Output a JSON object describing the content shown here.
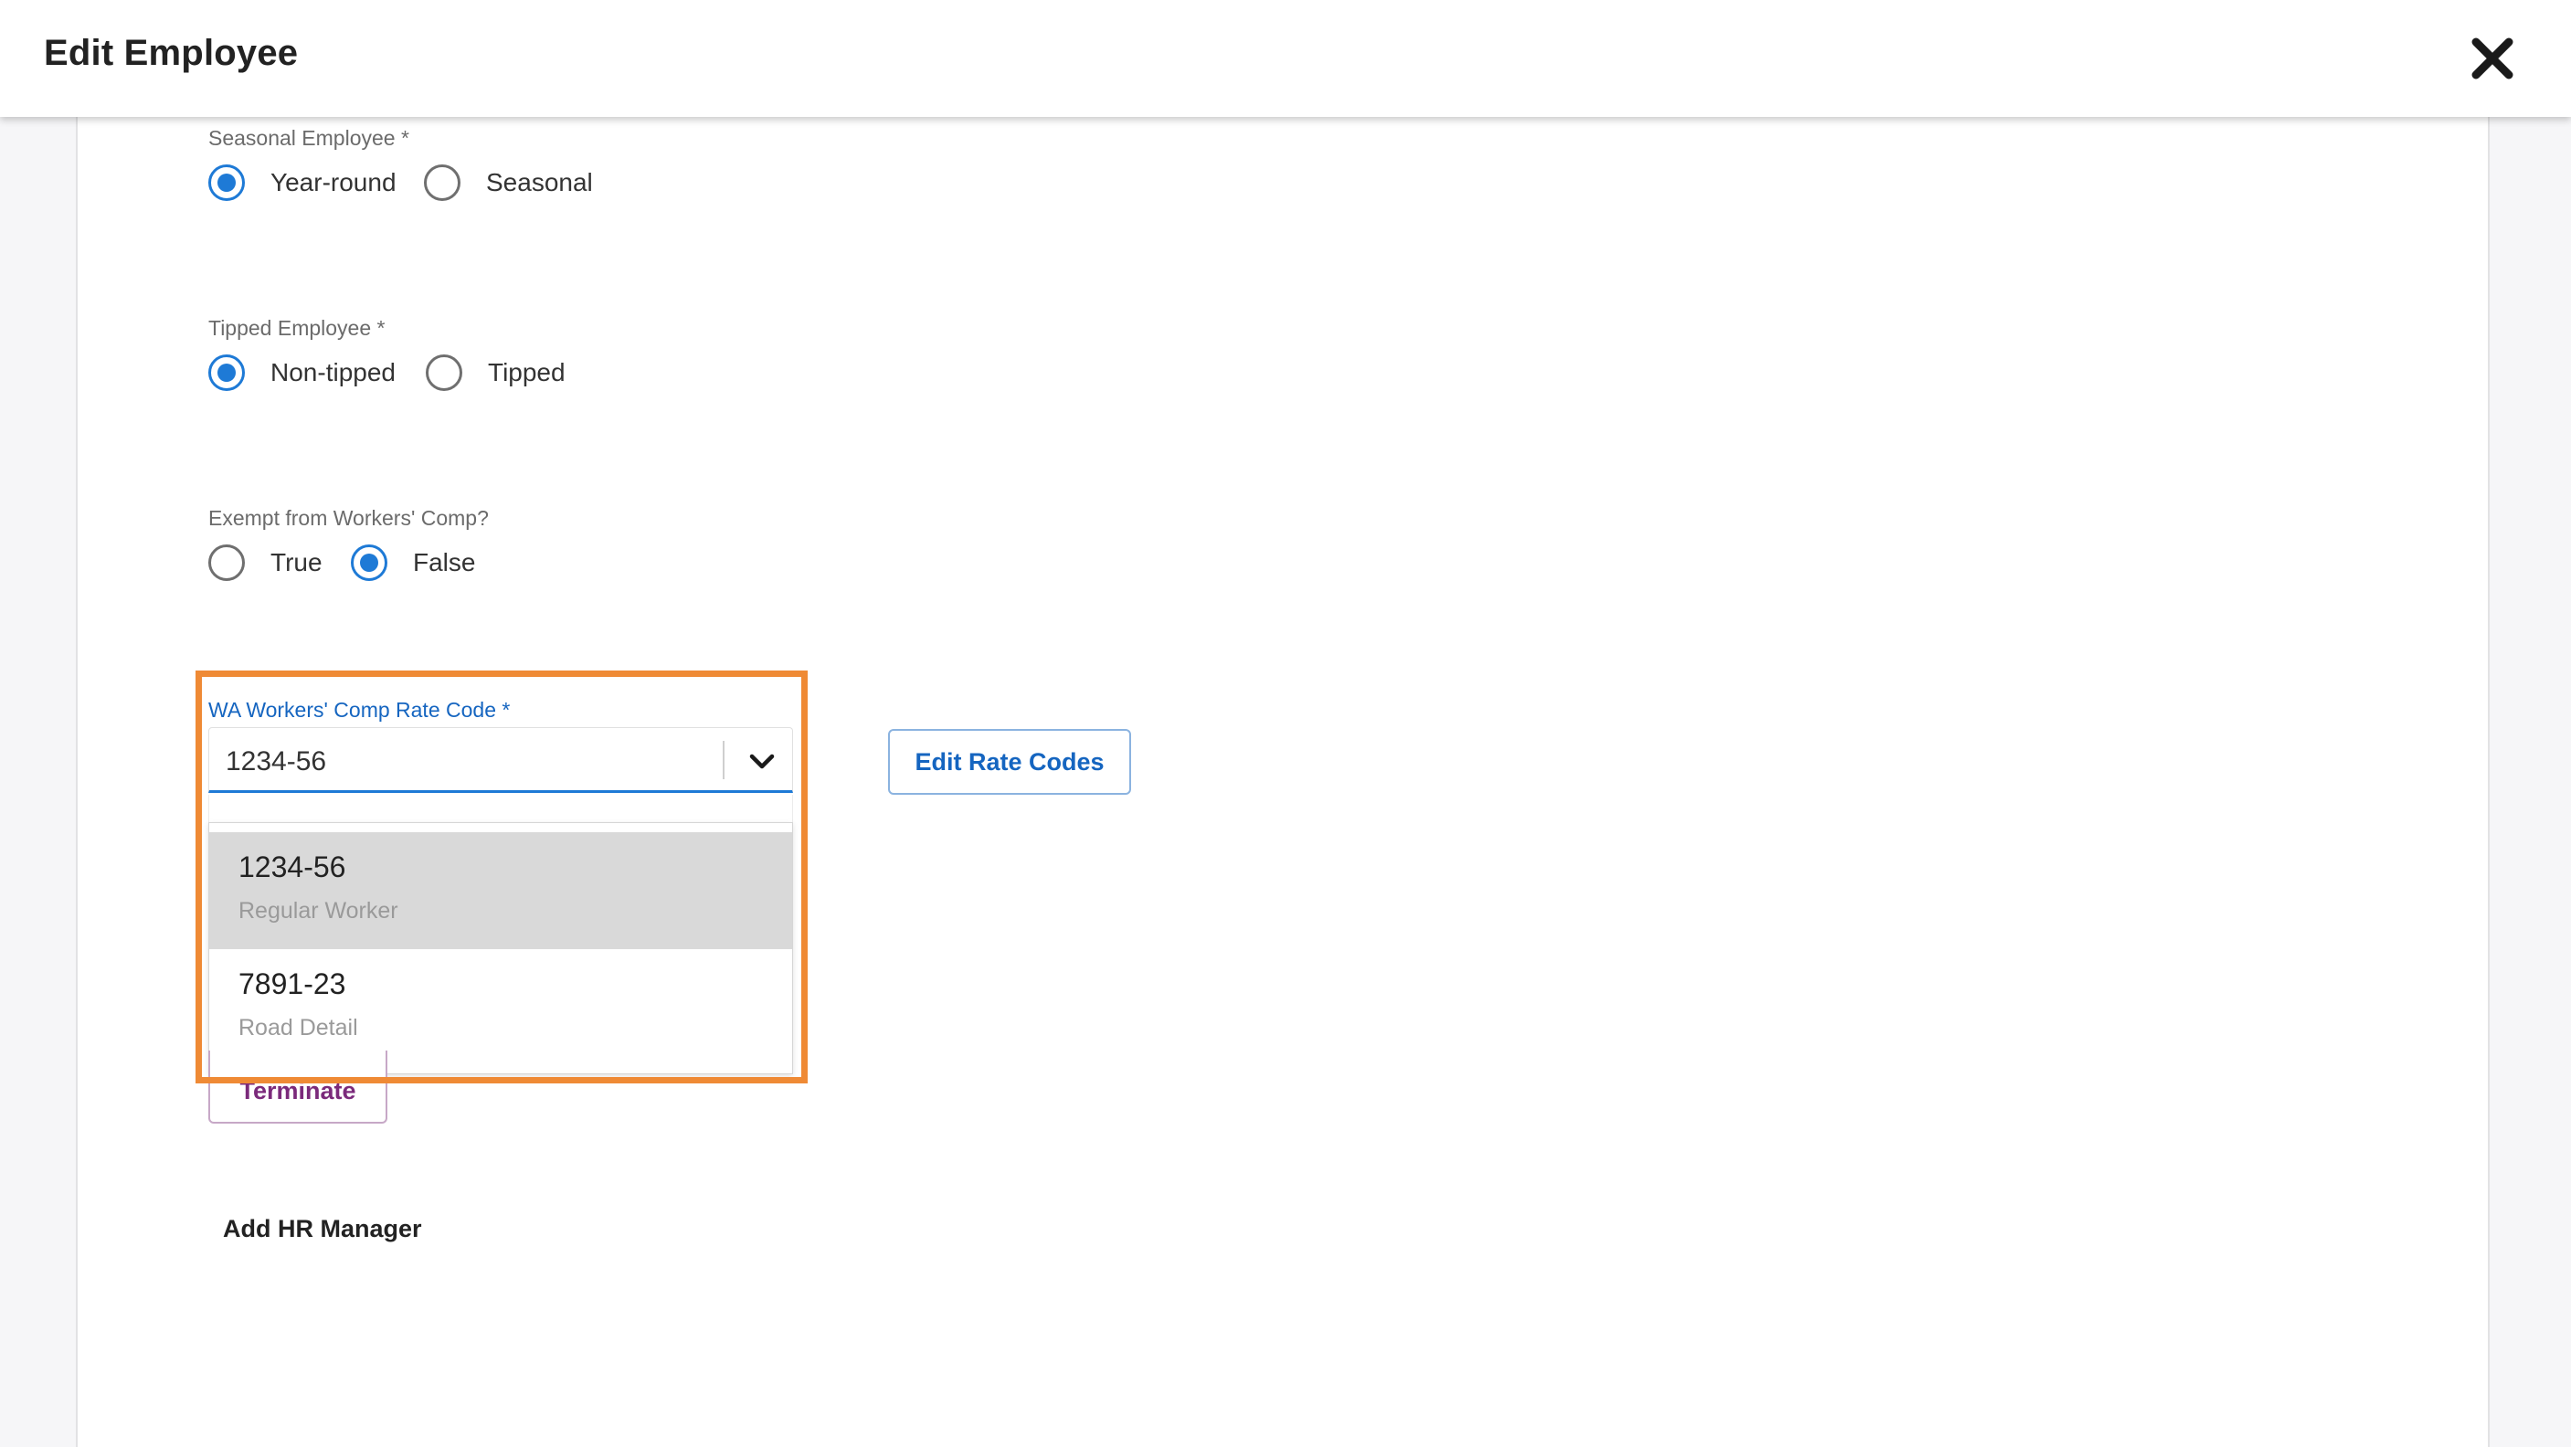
{
  "header": {
    "title": "Edit Employee",
    "close_icon": "close-icon"
  },
  "seasonal": {
    "label": "Seasonal Employee *",
    "options": [
      {
        "label": "Year-round",
        "checked": true
      },
      {
        "label": "Seasonal",
        "checked": false
      }
    ]
  },
  "tipped": {
    "label": "Tipped Employee *",
    "options": [
      {
        "label": "Non-tipped",
        "checked": true
      },
      {
        "label": "Tipped",
        "checked": false
      }
    ]
  },
  "exempt": {
    "label": "Exempt from Workers' Comp?",
    "options": [
      {
        "label": "True",
        "checked": false
      },
      {
        "label": "False",
        "checked": true
      }
    ]
  },
  "rate_code": {
    "label": "WA Workers' Comp Rate Code *",
    "value": "1234-56",
    "options": [
      {
        "code": "1234-56",
        "description": "Regular Worker",
        "selected": true
      },
      {
        "code": "7891-23",
        "description": "Road Detail",
        "selected": false
      }
    ]
  },
  "buttons": {
    "edit_rate_codes": "Edit Rate Codes",
    "terminate": "Terminate",
    "add_hr_manager": "Add HR Manager"
  },
  "colors": {
    "accent": "#1e7ad6",
    "highlight": "#ef8a35",
    "terminate": "#7b2a7b"
  }
}
